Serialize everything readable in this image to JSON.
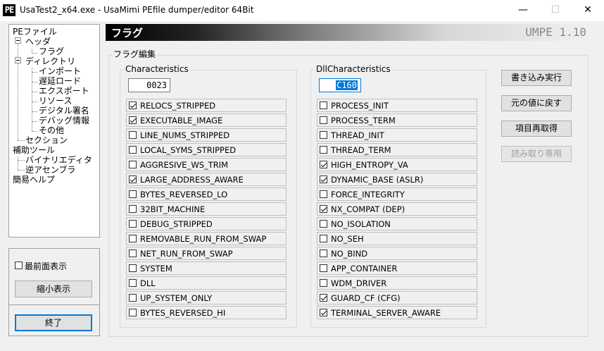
{
  "window": {
    "icon_text": "PE",
    "title": "UsaTest2_x64.exe - UsaMimi PEfile dumper/editor 64Bit",
    "min_glyph": "—",
    "max_glyph": "☐",
    "close_glyph": "✕"
  },
  "tree": {
    "root": "PEファイル",
    "header": "ヘッダ",
    "flags": "フラグ",
    "directory": "ディレクトリ",
    "import": "インポート",
    "delay_load": "遅延ロード",
    "export": "エクスポート",
    "resource": "リソース",
    "digital_sig": "デジタル署名",
    "debug_info": "デバッグ情報",
    "other": "その他",
    "section": "セクション",
    "tools": "補助ツール",
    "binary_editor": "バイナリエディタ",
    "disassembler": "逆アセンブラ",
    "help": "簡易ヘルプ"
  },
  "left_panel": {
    "topmost_label": "最前面表示",
    "topmost_checked": false,
    "shrink_label": "縮小表示",
    "exit_label": "終了"
  },
  "header": {
    "title": "フラグ",
    "brand": "UMPE 1.10"
  },
  "flag_edit": {
    "group_label": "フラグ編集",
    "characteristics": {
      "label": "Characteristics",
      "value": "0023",
      "flags": [
        {
          "label": "RELOCS_STRIPPED",
          "checked": true
        },
        {
          "label": "EXECUTABLE_IMAGE",
          "checked": true
        },
        {
          "label": "LINE_NUMS_STRIPPED",
          "checked": false
        },
        {
          "label": "LOCAL_SYMS_STRIPPED",
          "checked": false
        },
        {
          "label": "AGGRESIVE_WS_TRIM",
          "checked": false
        },
        {
          "label": "LARGE_ADDRESS_AWARE",
          "checked": true
        },
        {
          "label": "BYTES_REVERSED_LO",
          "checked": false
        },
        {
          "label": "32BIT_MACHINE",
          "checked": false
        },
        {
          "label": "DEBUG_STRIPPED",
          "checked": false
        },
        {
          "label": "REMOVABLE_RUN_FROM_SWAP",
          "checked": false
        },
        {
          "label": "NET_RUN_FROM_SWAP",
          "checked": false
        },
        {
          "label": "SYSTEM",
          "checked": false
        },
        {
          "label": "DLL",
          "checked": false
        },
        {
          "label": "UP_SYSTEM_ONLY",
          "checked": false
        },
        {
          "label": "BYTES_REVERSED_HI",
          "checked": false
        }
      ]
    },
    "dll_characteristics": {
      "label": "DllCharacteristics",
      "value": "C160",
      "flags": [
        {
          "label": "PROCESS_INIT",
          "checked": false
        },
        {
          "label": "PROCESS_TERM",
          "checked": false
        },
        {
          "label": "THREAD_INIT",
          "checked": false
        },
        {
          "label": "THREAD_TERM",
          "checked": false
        },
        {
          "label": "HIGH_ENTROPY_VA",
          "checked": true
        },
        {
          "label": "DYNAMIC_BASE (ASLR)",
          "checked": true
        },
        {
          "label": "FORCE_INTEGRITY",
          "checked": false
        },
        {
          "label": "NX_COMPAT (DEP)",
          "checked": true
        },
        {
          "label": "NO_ISOLATION",
          "checked": false
        },
        {
          "label": "NO_SEH",
          "checked": false
        },
        {
          "label": "NO_BIND",
          "checked": false
        },
        {
          "label": "APP_CONTAINER",
          "checked": false
        },
        {
          "label": "WDM_DRIVER",
          "checked": false
        },
        {
          "label": "GUARD_CF (CFG)",
          "checked": true
        },
        {
          "label": "TERMINAL_SERVER_AWARE",
          "checked": true
        }
      ]
    }
  },
  "actions": {
    "write": "書き込み実行",
    "revert": "元の値に戻す",
    "reload": "項目再取得",
    "readonly": "読み取り専用"
  }
}
